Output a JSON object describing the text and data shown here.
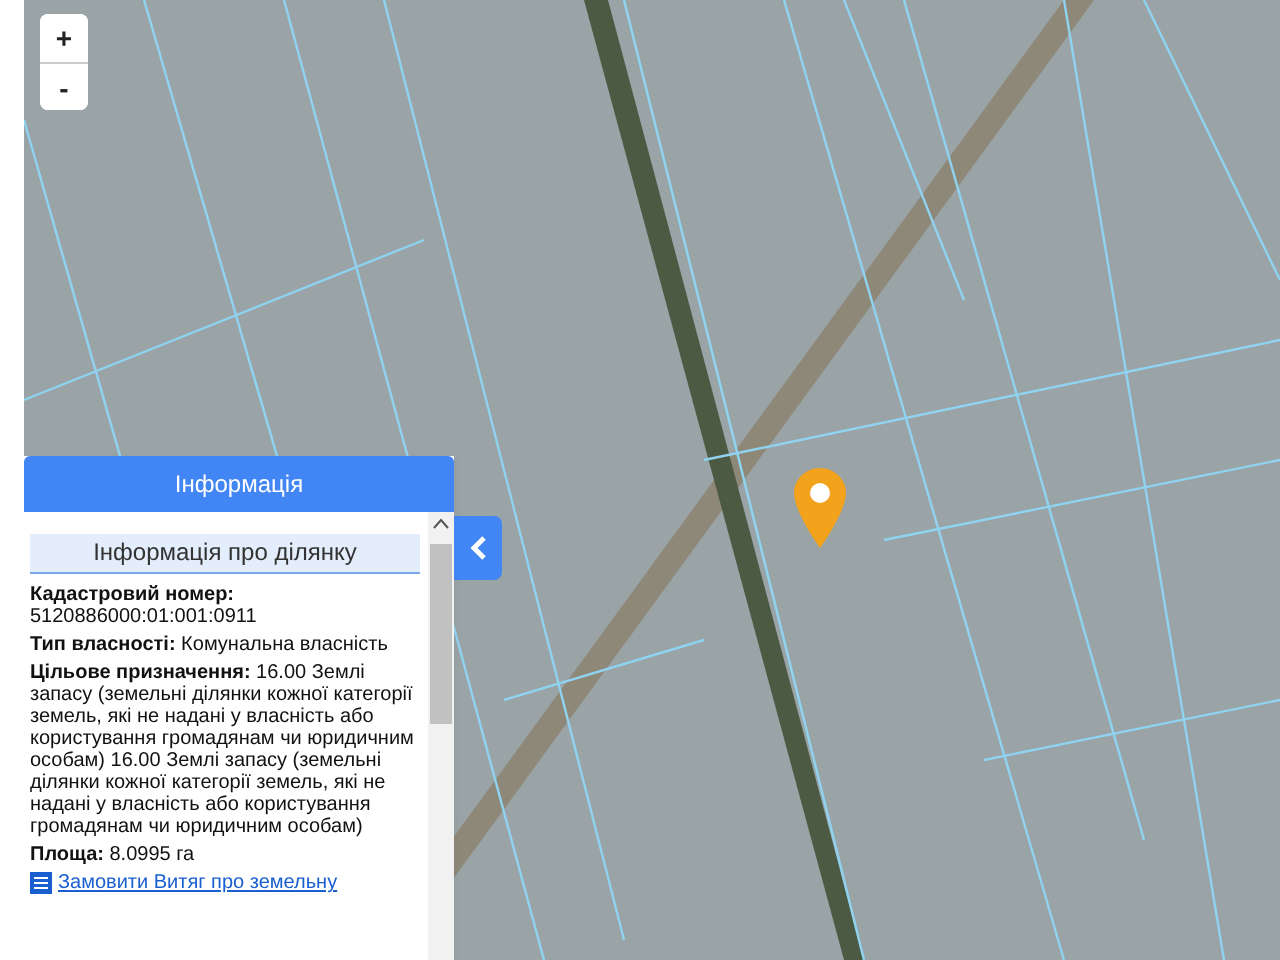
{
  "map": {
    "zoom_controls": [
      "+",
      "-"
    ]
  },
  "info_panel": {
    "title": "Інформація",
    "section_title": "Інформація про ділянку",
    "fields": [
      {
        "label": "Кадастровий номер:",
        "value": "5120886000:01:001:0911",
        "kind": "block"
      },
      {
        "label": "Тип власності:",
        "value": "Комунальна власність",
        "kind": "inline"
      },
      {
        "label": "Цільове призначення:",
        "value": "16.00 Землі запасу (земельні ділянки кожної категорії земель, які не надані у власність або користування громадянам чи юридичним особам) 16.00 Землі запасу (земельні ділянки кожної категорії земель, які не надані у власність або користування громадянам чи юридичним особам)",
        "kind": "inline"
      },
      {
        "label": "Площа:",
        "value": "8.0995 га",
        "kind": "inline"
      }
    ],
    "link": "Замовити Витяг про земельну"
  }
}
